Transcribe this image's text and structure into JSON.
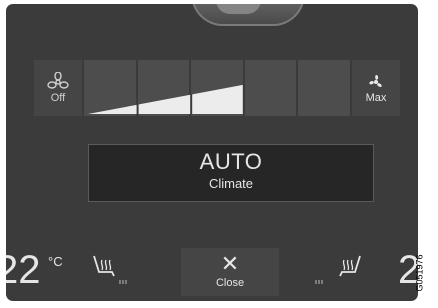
{
  "fan": {
    "off_label": "Off",
    "max_label": "Max",
    "level_steps": 5,
    "current_level": 3,
    "colors": {
      "fill": "#ececec",
      "bg": "#4d4d4d"
    }
  },
  "climate": {
    "mode_title": "AUTO",
    "mode_subtitle": "Climate"
  },
  "bottom": {
    "left_temp": "22",
    "temp_unit": "°C",
    "close_label": "Close",
    "close_icon": "close-icon",
    "right_temp": "2",
    "left_seat_heat": "seat-heat-icon",
    "right_seat_heat": "seat-heat-icon"
  },
  "figure_code": "G051976"
}
